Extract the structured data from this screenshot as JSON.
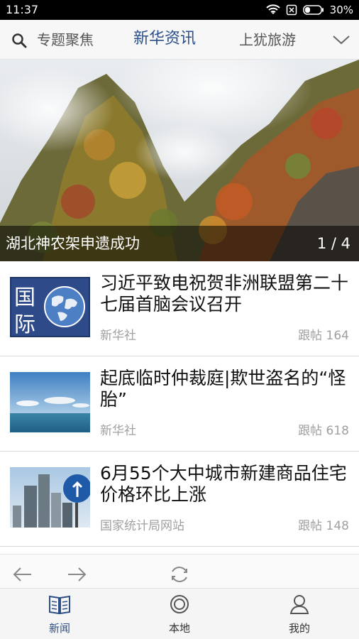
{
  "status_bar": {
    "time": "11:37",
    "battery": "30%"
  },
  "top_nav": {
    "tabs": [
      {
        "label": "专题聚焦"
      },
      {
        "label": "新华资讯",
        "active": true
      },
      {
        "label": "上犹旅游"
      }
    ]
  },
  "banner": {
    "caption": "湖北神农架申遗成功",
    "counter": "1 / 4"
  },
  "news": [
    {
      "title": "习近平致电祝贺非洲联盟第二十七届首脑会议召开",
      "source": "新华社",
      "comments": "跟帖 164",
      "thumb_text": [
        "国",
        "际"
      ]
    },
    {
      "title": "起底临时仲裁庭|欺世盗名的“怪胎”",
      "source": "新华社",
      "comments": "跟帖 618"
    },
    {
      "title": "6月55个大中城市新建商品住宅价格环比上涨",
      "source": "国家统计局网站",
      "comments": "跟帖 148"
    }
  ],
  "tab_bar": {
    "items": [
      {
        "label": "新闻",
        "active": true
      },
      {
        "label": "本地"
      },
      {
        "label": "我的"
      }
    ]
  },
  "colors": {
    "accent": "#2c4f8a",
    "muted_text": "#a0a0a0"
  }
}
